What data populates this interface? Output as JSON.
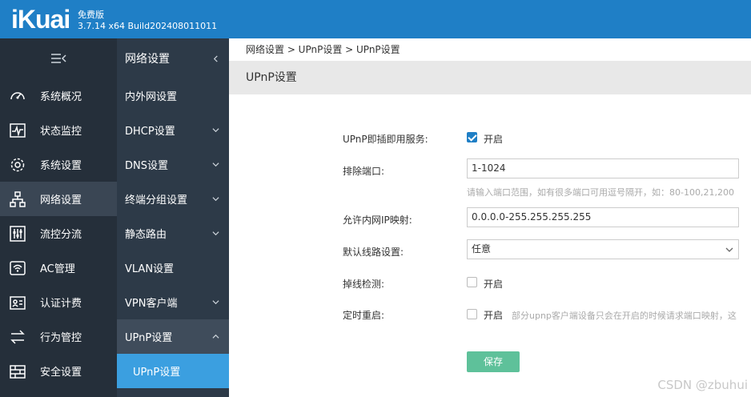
{
  "header": {
    "logo": "iKuai",
    "edition": "免费版",
    "build": "3.7.14 x64 Build202408011011"
  },
  "leftnav": {
    "items": [
      {
        "label": "系统概况",
        "icon": "gauge-icon"
      },
      {
        "label": "状态监控",
        "icon": "monitor-wave-icon"
      },
      {
        "label": "系统设置",
        "icon": "gear-icon"
      },
      {
        "label": "网络设置",
        "icon": "network-icon"
      },
      {
        "label": "流控分流",
        "icon": "sliders-icon"
      },
      {
        "label": "AC管理",
        "icon": "wifi-router-icon"
      },
      {
        "label": "认证计费",
        "icon": "id-card-icon"
      },
      {
        "label": "行为管控",
        "icon": "arrows-exchange-icon"
      },
      {
        "label": "安全设置",
        "icon": "firewall-icon"
      }
    ]
  },
  "subnav": {
    "title": "网络设置",
    "items": [
      {
        "label": "内外网设置"
      },
      {
        "label": "DHCP设置"
      },
      {
        "label": "DNS设置"
      },
      {
        "label": "终端分组设置"
      },
      {
        "label": "静态路由"
      },
      {
        "label": "VLAN设置"
      },
      {
        "label": "VPN客户端"
      },
      {
        "label": "UPnP设置"
      },
      {
        "label": "UPnP设置"
      }
    ]
  },
  "content": {
    "breadcrumb": "网络设置 > UPnP设置 > UPnP设置",
    "title": "UPnP设置",
    "form": {
      "service_label": "UPnP即插即用服务:",
      "service_option": "开启",
      "service_checked": true,
      "exclude_label": "排除端口:",
      "exclude_value": "1-1024",
      "exclude_hint": "请输入端口范围，如有很多端口可用逗号隔开，如：80-100,21,200",
      "allow_label": "允许内网IP映射:",
      "allow_value": "0.0.0.0-255.255.255.255",
      "line_label": "默认线路设置:",
      "line_value": "任意",
      "drop_label": "掉线检测:",
      "drop_option": "开启",
      "reboot_label": "定时重启:",
      "reboot_option": "开启",
      "reboot_hint": "部分upnp客户端设备只会在开启的时候请求端口映射，这",
      "save_label": "保存"
    }
  },
  "watermark": "CSDN @zbuhui",
  "colors": {
    "header": "#1f7fc6",
    "leftnav": "#252f3a",
    "subnav": "#2d3a48",
    "active_child": "#3b9fe0",
    "save": "#5ec19a"
  }
}
